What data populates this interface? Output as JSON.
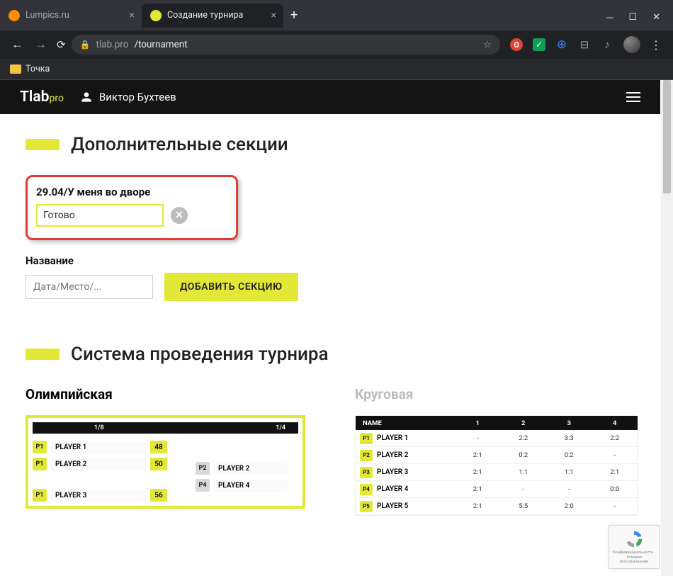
{
  "browser": {
    "tabs": [
      {
        "title": "Lumpics.ru",
        "favicon": "#ff8c00"
      },
      {
        "title": "Создание турнира",
        "favicon": "#e3e836"
      }
    ],
    "url_host": "tlab.pro",
    "url_path": "/tournament",
    "bookmark": "Точка"
  },
  "header": {
    "logo_main": "Tlab",
    "logo_sub": "pro",
    "user_name": "Виктор Бухтеев"
  },
  "sections_heading": "Дополнительные секции",
  "highlight": {
    "title": "29.04/У меня во дворе",
    "input_value": "Готово"
  },
  "name_block": {
    "label": "Название",
    "placeholder": "Дата/Место/...",
    "button": "ДОБАВИТЬ СЕКЦИЮ"
  },
  "system_heading": "Система проведения турнира",
  "system_a": {
    "title": "Олимпийская",
    "col1": "1/8",
    "col2": "1/4",
    "left": [
      {
        "badge": "P1",
        "name": "PLAYER 1",
        "score": "48"
      },
      {
        "badge": "P1",
        "name": "PLAYER 2",
        "score": "50"
      },
      {
        "badge": "P1",
        "name": "PLAYER 3",
        "score": "56"
      }
    ],
    "right": [
      {
        "badge": "P2",
        "name": "PLAYER 2"
      },
      {
        "badge": "P4",
        "name": "PLAYER 4"
      }
    ]
  },
  "system_b": {
    "title": "Круговая",
    "head_name": "NAME",
    "head_cols": [
      "1",
      "2",
      "3",
      "4"
    ],
    "rows": [
      {
        "badge": "P1",
        "name": "PLAYER 1",
        "cells": [
          "-",
          "2:2",
          "3:3",
          "2:2"
        ]
      },
      {
        "badge": "P2",
        "name": "PLAYER 2",
        "cells": [
          "2:1",
          "0:2",
          "0:2",
          "-"
        ]
      },
      {
        "badge": "P3",
        "name": "PLAYER 3",
        "cells": [
          "2:1",
          "1:1",
          "1:1",
          "2:1"
        ]
      },
      {
        "badge": "P4",
        "name": "PLAYER 4",
        "cells": [
          "2:1",
          "-",
          "-",
          "0:0"
        ]
      },
      {
        "badge": "P5",
        "name": "PLAYER 5",
        "cells": [
          "2:1",
          "5:5",
          "2:0",
          "-"
        ]
      }
    ]
  },
  "recaptcha_text": "Конфиденциальность - Условия использования"
}
